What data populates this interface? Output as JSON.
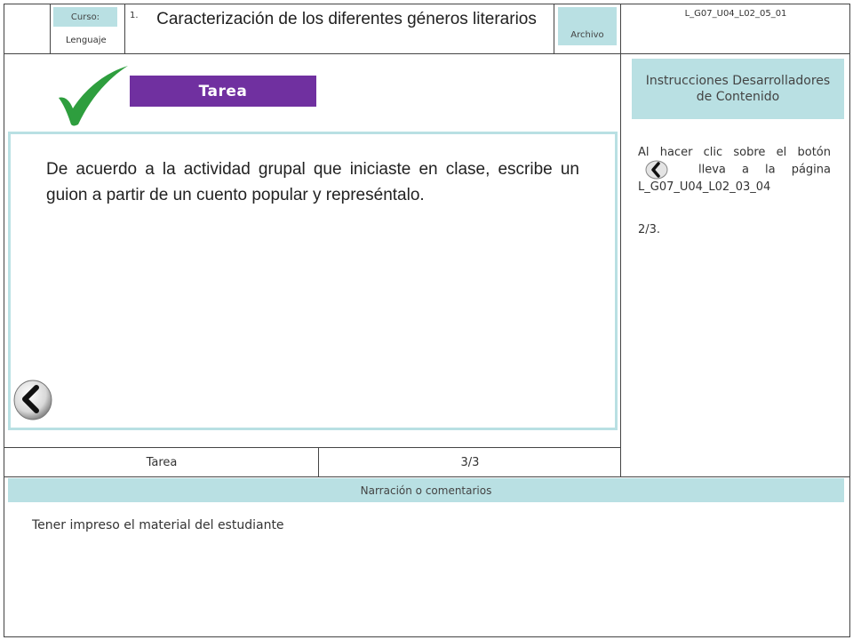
{
  "header": {
    "curso_label": "Curso:",
    "curso_value": "Lenguaje",
    "number": "1.",
    "title": "Caracterización de los diferentes géneros literarios",
    "archivo_label": "Archivo",
    "page_code": "L_G07_U04_L02_05_01"
  },
  "slide": {
    "banner": "Tarea",
    "task_text": "De acuerdo a la actividad grupal que iniciaste en clase, escribe un guion a partir de un cuento popular y represéntalo.",
    "icons": [
      "checkmark-icon",
      "back-arrow-icon"
    ]
  },
  "developer_panel": {
    "header": "Instrucciones Desarrolladores de Contenido",
    "instruction_before": "Al hacer clic sobre el botón",
    "instruction_after": "lleva a la página L_G07_U04_L02_03_04",
    "extra": "2/3."
  },
  "footer": {
    "tab_label": "Tarea",
    "page_number": "3/3"
  },
  "narration": {
    "header": "Narración o comentarios",
    "text": "Tener impreso el material del estudiante"
  },
  "colors": {
    "banner": "#7030a0",
    "teal": "#b9e0e3",
    "checkmark": "#2e9e3e"
  }
}
